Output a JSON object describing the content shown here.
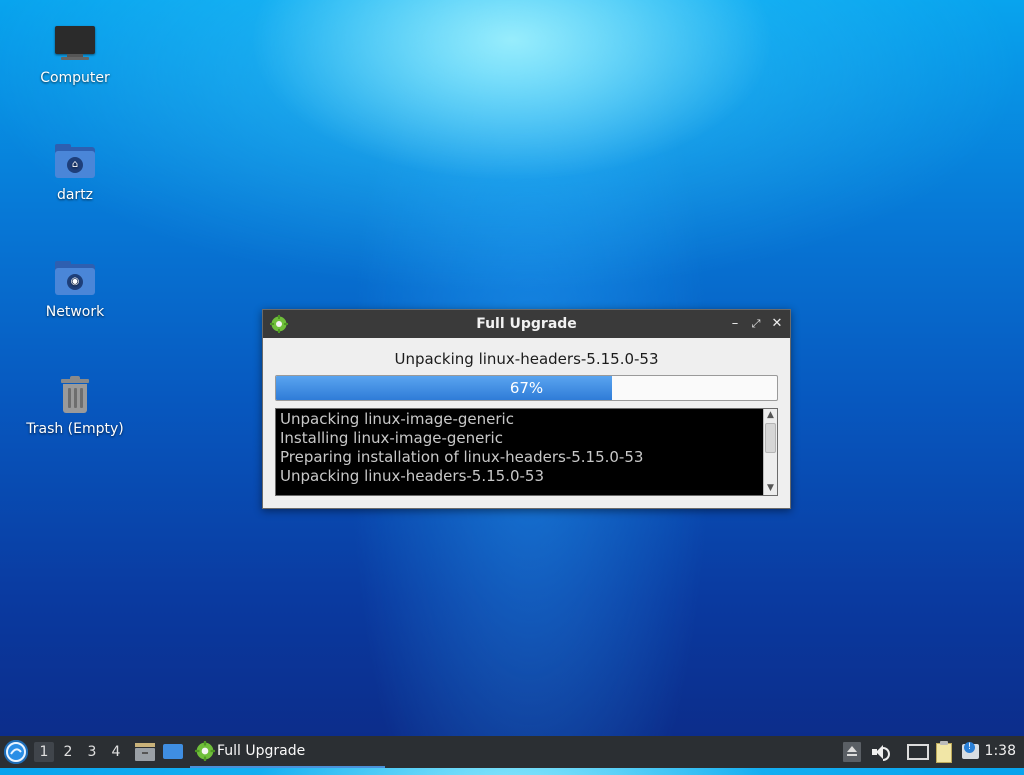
{
  "desktop": {
    "icons": [
      {
        "label": "Computer",
        "icon": "computer-icon"
      },
      {
        "label": "dartz",
        "icon": "home-folder-icon"
      },
      {
        "label": "Network",
        "icon": "network-folder-icon"
      },
      {
        "label": "Trash (Empty)",
        "icon": "trash-icon"
      }
    ]
  },
  "window": {
    "title": "Full Upgrade",
    "icon": "gear-icon",
    "controls": {
      "minimize": "–",
      "maximize": "⤢",
      "close": "✕"
    },
    "status": "Unpacking linux-headers-5.15.0-53",
    "progress": {
      "value": 67,
      "label": "67%"
    },
    "log": [
      "Unpacking linux-image-generic",
      "Installing linux-image-generic",
      "Preparing installation of linux-headers-5.15.0-53",
      "Unpacking linux-headers-5.15.0-53"
    ],
    "scroll": {
      "up": "▲",
      "down": "▼"
    }
  },
  "taskbar": {
    "start_icon": "lubuntu-start-icon",
    "workspaces": [
      "1",
      "2",
      "3",
      "4"
    ],
    "active_workspace": "1",
    "quick_launch": [
      "file-manager-icon",
      "show-desktop-icon"
    ],
    "task_label": "Full Upgrade",
    "tray": [
      "eject-icon",
      "volume-icon",
      "network-icon",
      "clipboard-icon",
      "update-notifier-icon"
    ],
    "clock": "1:38"
  },
  "colors": {
    "accent": "#4a90d9",
    "progress_fill": "#3f8ee2",
    "titlebar": "#3a3a3a",
    "taskbar": "#2b2f33"
  }
}
